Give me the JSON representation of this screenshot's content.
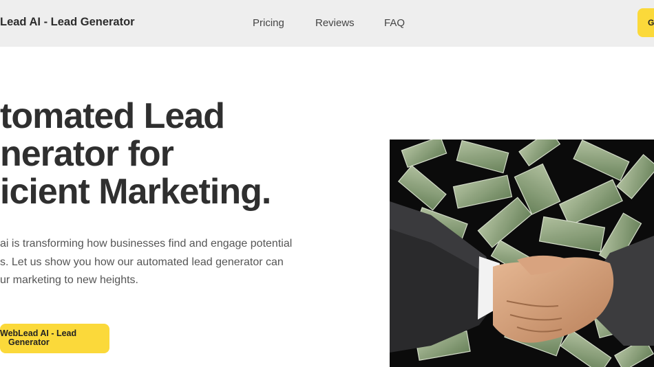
{
  "header": {
    "brand": "Lead AI - Lead Generator",
    "nav": {
      "pricing": "Pricing",
      "reviews": "Reviews",
      "faq": "FAQ"
    },
    "cta_label": "G"
  },
  "hero": {
    "title_lines": [
      "tomated Lead",
      "nerator for",
      "icient Marketing."
    ],
    "description_lines": [
      "ai is transforming how businesses find and engage potential",
      "s. Let us show you how our automated lead generator can",
      "ur marketing to new heights."
    ],
    "cta_lines": [
      "WebLead AI - Lead",
      "Generator"
    ],
    "image_icon": "handshake-money-photo"
  },
  "colors": {
    "accent": "#fbd93a",
    "header_bg": "#eeeeee",
    "title": "#2f2f2f",
    "body_text": "#555555"
  }
}
